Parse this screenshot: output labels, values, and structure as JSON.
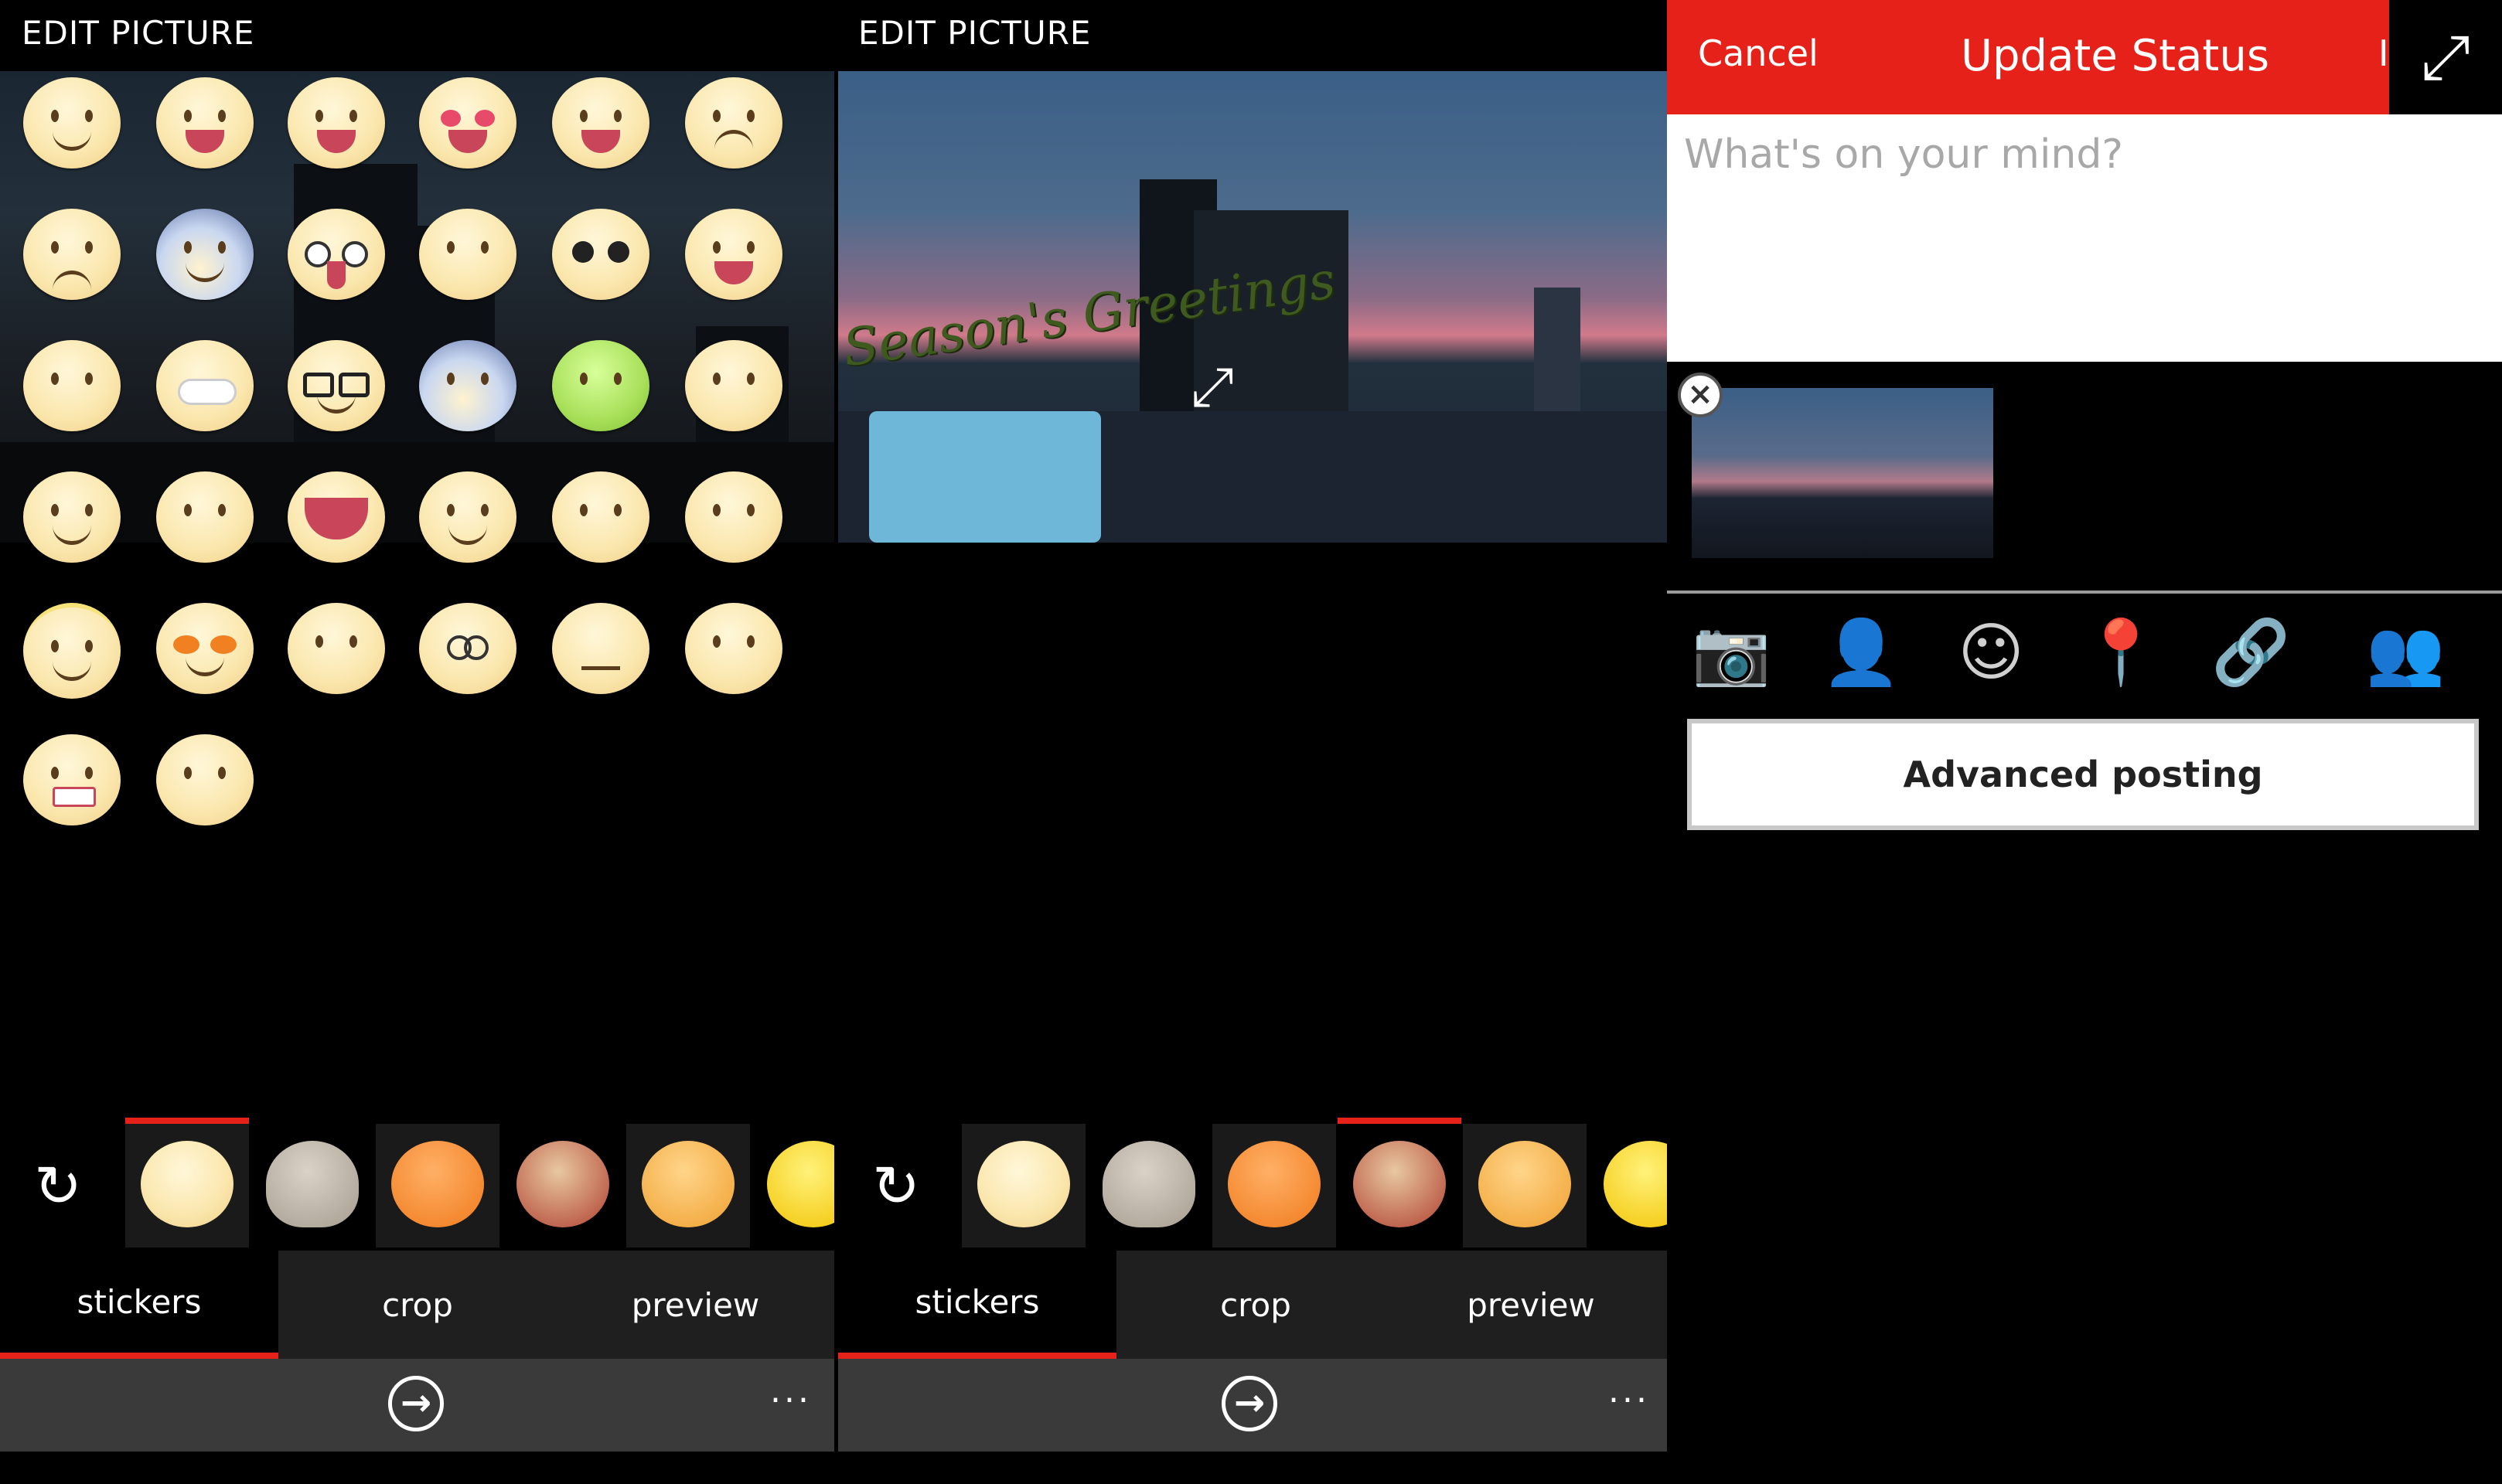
{
  "edit": {
    "title": "EDIT PICTURE"
  },
  "tabs": {
    "stickers": "stickers",
    "crop": "crop",
    "preview": "preview"
  },
  "appbar": {
    "next_icon": "→",
    "more": "..."
  },
  "stickers": {
    "refresh_icon": "↻"
  },
  "preview": {
    "greeting": "Season's Greetings"
  },
  "status": {
    "cancel": "Cancel",
    "title": "Update Status",
    "clipped": "I",
    "placeholder": "What's on your mind?",
    "remove": "×",
    "advanced": "Advanced posting"
  },
  "icons": {
    "expand": "⤢",
    "fullscreen": "⤢",
    "camera": "📷",
    "tag_friend": "👤",
    "emoji": "☺",
    "location": "📍",
    "link": "🔗",
    "audience": "👥"
  },
  "colors": {
    "accent": "#e5211a",
    "appbar": "#3a3a3a",
    "tab_inactive": "#1f1f1f"
  }
}
